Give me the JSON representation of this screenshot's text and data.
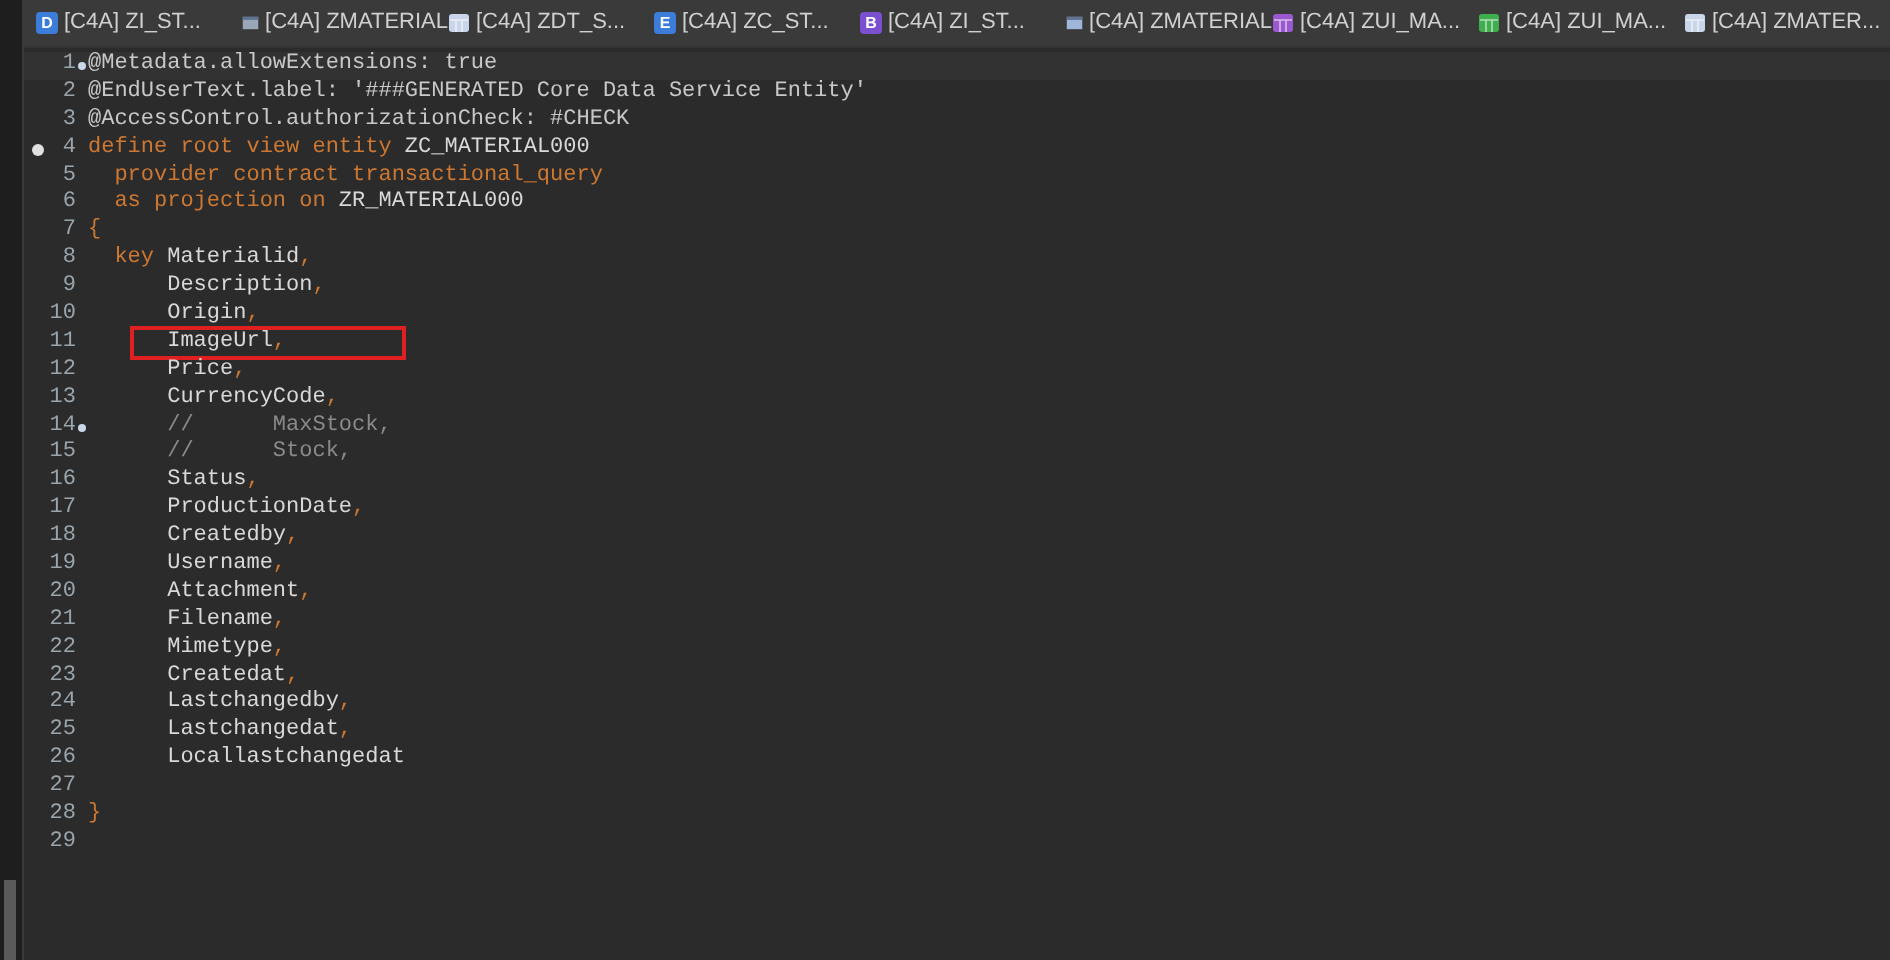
{
  "tabs": [
    {
      "label": "[C4A] ZI_ST...",
      "kind": "letter",
      "glyph": "D",
      "color": "#3b7dd8"
    },
    {
      "label": "[C4A] ZMATERIAL",
      "kind": "table",
      "color": "#9aa7b8"
    },
    {
      "label": "[C4A] ZDT_S...",
      "kind": "grid",
      "color": "#c9d6ea"
    },
    {
      "label": "[C4A] ZC_ST...",
      "kind": "letter",
      "glyph": "E",
      "color": "#3b7dd8"
    },
    {
      "label": "[C4A] ZI_ST...",
      "kind": "letter",
      "glyph": "B",
      "color": "#7a4fd0"
    },
    {
      "label": "[C4A] ZMATERIAL",
      "kind": "table",
      "color": "#9fb6d8"
    },
    {
      "label": "[C4A] ZUI_MA...",
      "kind": "grid",
      "color": "#9b59d0"
    },
    {
      "label": "[C4A] ZUI_MA...",
      "kind": "grid",
      "color": "#3fae4f"
    },
    {
      "label": "[C4A] ZMATER...",
      "kind": "grid",
      "color": "#c9d6ea"
    }
  ],
  "lines": [
    {
      "number": "1",
      "bookmark": true,
      "current": true,
      "tokens": [
        {
          "kind": "annotation",
          "text": "@Metadata.allowExtensions: true"
        }
      ]
    },
    {
      "number": "2",
      "tokens": [
        {
          "kind": "annotation",
          "text": "@EndUserText.label: '###GENERATED Core Data Service Entity'"
        }
      ]
    },
    {
      "number": "3",
      "tokens": [
        {
          "kind": "annotation",
          "text": "@AccessControl.authorizationCheck: #CHECK"
        }
      ]
    },
    {
      "number": "4",
      "breakpoint": true,
      "tokens": [
        {
          "kind": "keyword",
          "text": "define root view entity"
        },
        {
          "kind": "identifier",
          "text": " ZC_MATERIAL000"
        }
      ]
    },
    {
      "number": "5",
      "tokens": [
        {
          "kind": "keyword",
          "text": "  provider contract transactional_query"
        }
      ]
    },
    {
      "number": "6",
      "tokens": [
        {
          "kind": "keyword",
          "text": "  as projection on"
        },
        {
          "kind": "identifier",
          "text": " ZR_MATERIAL000"
        }
      ]
    },
    {
      "number": "7",
      "tokens": [
        {
          "kind": "punct",
          "text": "{"
        }
      ]
    },
    {
      "number": "8",
      "tokens": [
        {
          "kind": "keyword",
          "text": "  key"
        },
        {
          "kind": "identifier",
          "text": " Materialid"
        },
        {
          "kind": "punct",
          "text": ","
        }
      ]
    },
    {
      "number": "9",
      "tokens": [
        {
          "kind": "identifier",
          "text": "      Description"
        },
        {
          "kind": "punct",
          "text": ","
        }
      ]
    },
    {
      "number": "10",
      "tokens": [
        {
          "kind": "identifier",
          "text": "      Origin"
        },
        {
          "kind": "punct",
          "text": ","
        }
      ]
    },
    {
      "number": "11",
      "boxed": true,
      "tokens": [
        {
          "kind": "identifier",
          "text": "      ImageUrl"
        },
        {
          "kind": "punct",
          "text": ","
        }
      ]
    },
    {
      "number": "12",
      "tokens": [
        {
          "kind": "identifier",
          "text": "      Price"
        },
        {
          "kind": "punct",
          "text": ","
        }
      ]
    },
    {
      "number": "13",
      "tokens": [
        {
          "kind": "identifier",
          "text": "      CurrencyCode"
        },
        {
          "kind": "punct",
          "text": ","
        }
      ]
    },
    {
      "number": "14",
      "bookmark": true,
      "tokens": [
        {
          "kind": "comment",
          "text": "      //      MaxStock,"
        }
      ]
    },
    {
      "number": "15",
      "tokens": [
        {
          "kind": "comment",
          "text": "      //      Stock,"
        }
      ]
    },
    {
      "number": "16",
      "tokens": [
        {
          "kind": "identifier",
          "text": "      Status"
        },
        {
          "kind": "punct",
          "text": ","
        }
      ]
    },
    {
      "number": "17",
      "tokens": [
        {
          "kind": "identifier",
          "text": "      ProductionDate"
        },
        {
          "kind": "punct",
          "text": ","
        }
      ]
    },
    {
      "number": "18",
      "tokens": [
        {
          "kind": "identifier",
          "text": "      Createdby"
        },
        {
          "kind": "punct",
          "text": ","
        }
      ]
    },
    {
      "number": "19",
      "tokens": [
        {
          "kind": "identifier",
          "text": "      Username"
        },
        {
          "kind": "punct",
          "text": ","
        }
      ]
    },
    {
      "number": "20",
      "tokens": [
        {
          "kind": "identifier",
          "text": "      Attachment"
        },
        {
          "kind": "punct",
          "text": ","
        }
      ]
    },
    {
      "number": "21",
      "tokens": [
        {
          "kind": "identifier",
          "text": "      Filename"
        },
        {
          "kind": "punct",
          "text": ","
        }
      ]
    },
    {
      "number": "22",
      "tokens": [
        {
          "kind": "identifier",
          "text": "      Mimetype"
        },
        {
          "kind": "punct",
          "text": ","
        }
      ]
    },
    {
      "number": "23",
      "tokens": [
        {
          "kind": "identifier",
          "text": "      Createdat"
        },
        {
          "kind": "punct",
          "text": ","
        }
      ]
    },
    {
      "number": "24",
      "tokens": [
        {
          "kind": "identifier",
          "text": "      Lastchangedby"
        },
        {
          "kind": "punct",
          "text": ","
        }
      ]
    },
    {
      "number": "25",
      "tokens": [
        {
          "kind": "identifier",
          "text": "      Lastchangedat"
        },
        {
          "kind": "punct",
          "text": ","
        }
      ]
    },
    {
      "number": "26",
      "tokens": [
        {
          "kind": "identifier",
          "text": "      Locallastchangedat"
        }
      ]
    },
    {
      "number": "27"
    },
    {
      "number": "28",
      "tokens": [
        {
          "kind": "punct",
          "text": "}"
        }
      ]
    },
    {
      "number": "29"
    }
  ]
}
